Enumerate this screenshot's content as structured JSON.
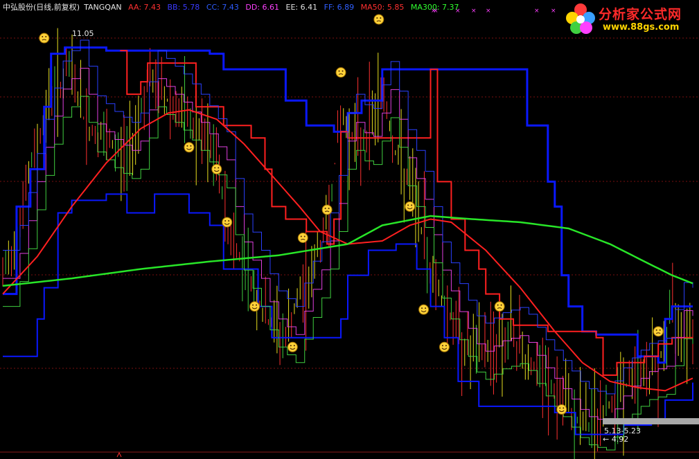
{
  "header": {
    "stock_name": "中弘股份(日线,前复权)",
    "indicator": "TANGQAN",
    "items": [
      {
        "label": "AA: 7.43",
        "color": "#ff3030"
      },
      {
        "label": "BB: 5.78",
        "color": "#3a3aff"
      },
      {
        "label": "CC: 7.43",
        "color": "#2e5cff"
      },
      {
        "label": "DD: 6.61",
        "color": "#ff40ff"
      },
      {
        "label": "EE: 6.41",
        "color": "#e0e0e0"
      },
      {
        "label": "FF: 6.89",
        "color": "#3060ff"
      },
      {
        "label": "MA50: 5.85",
        "color": "#ff3030"
      },
      {
        "label": "MA300: 7.37",
        "color": "#30ff30"
      }
    ]
  },
  "logo": {
    "title": "分析家公式网",
    "url": "www.88gs.com"
  },
  "annotations": {
    "high_label": "11.05",
    "range_label": "5.13-5.23",
    "low_label": "4.92"
  },
  "chart_data": {
    "type": "line",
    "title": "TANGQAN",
    "price_range": [
      4.7,
      11.6
    ],
    "high": 11.05,
    "low": 4.92,
    "colors": {
      "AA": "#ff2020",
      "BB": "#0a18ff",
      "MA50": "#ff2020",
      "MA300": "#28e628",
      "magenta": "#e040e0",
      "green_band": "#40d040",
      "thin_blue": "#2a40ff",
      "candle_up": "#ff3030",
      "candle_down": "#e8e020",
      "candle_green": "#40d040"
    },
    "series": [
      {
        "name": "MA300",
        "values": [
          [
            0,
            7.33
          ],
          [
            0.1,
            7.45
          ],
          [
            0.2,
            7.6
          ],
          [
            0.3,
            7.72
          ],
          [
            0.4,
            7.82
          ],
          [
            0.5,
            8.0
          ],
          [
            0.55,
            8.3
          ],
          [
            0.62,
            8.45
          ],
          [
            0.68,
            8.4
          ],
          [
            0.75,
            8.35
          ],
          [
            0.82,
            8.25
          ],
          [
            0.88,
            8.0
          ],
          [
            0.93,
            7.72
          ],
          [
            0.97,
            7.5
          ],
          [
            1.0,
            7.37
          ]
        ]
      },
      {
        "name": "MA50",
        "values": [
          [
            0,
            7.2
          ],
          [
            0.05,
            7.8
          ],
          [
            0.1,
            8.6
          ],
          [
            0.15,
            9.3
          ],
          [
            0.2,
            9.85
          ],
          [
            0.24,
            10.1
          ],
          [
            0.27,
            10.15
          ],
          [
            0.31,
            10.0
          ],
          [
            0.35,
            9.6
          ],
          [
            0.39,
            9.1
          ],
          [
            0.43,
            8.6
          ],
          [
            0.46,
            8.2
          ],
          [
            0.5,
            8.0
          ],
          [
            0.55,
            8.05
          ],
          [
            0.59,
            8.3
          ],
          [
            0.62,
            8.4
          ],
          [
            0.65,
            8.35
          ],
          [
            0.7,
            7.9
          ],
          [
            0.75,
            7.3
          ],
          [
            0.8,
            6.6
          ],
          [
            0.84,
            6.1
          ],
          [
            0.88,
            5.8
          ],
          [
            0.92,
            5.7
          ],
          [
            0.96,
            5.65
          ],
          [
            1.0,
            5.85
          ]
        ]
      }
    ],
    "markers": {
      "smile": [
        [
          0.27,
          9.55
        ],
        [
          0.31,
          9.2
        ],
        [
          0.325,
          8.35
        ],
        [
          0.365,
          7.0
        ],
        [
          0.42,
          6.35
        ],
        [
          0.59,
          8.6
        ],
        [
          0.61,
          6.95
        ],
        [
          0.64,
          6.35
        ],
        [
          0.81,
          5.35
        ]
      ],
      "neutral": [
        [
          0.06,
          11.3
        ],
        [
          0.49,
          10.75
        ],
        [
          0.545,
          11.6
        ],
        [
          0.47,
          8.55
        ],
        [
          0.435,
          8.1
        ],
        [
          0.72,
          7.0
        ],
        [
          0.95,
          6.6
        ]
      ]
    }
  }
}
